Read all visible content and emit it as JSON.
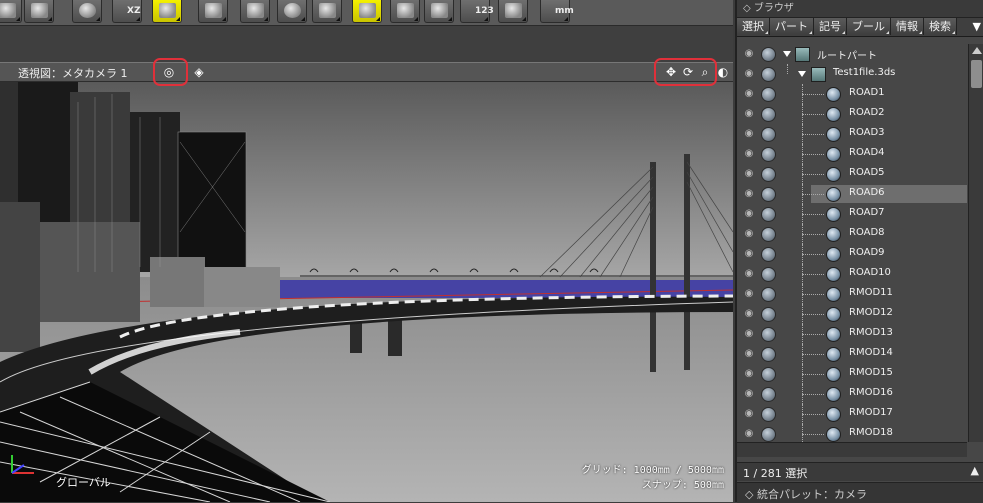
{
  "toolbar": {
    "buttons": [
      {
        "name": "box-icon"
      },
      {
        "name": "list-icon"
      },
      {
        "name": "globe-icon"
      },
      {
        "name": "xz-plane-icon",
        "label": "XZ"
      },
      {
        "name": "grid-single-icon"
      },
      {
        "name": "grid-multi-icon"
      },
      {
        "name": "table-icon"
      },
      {
        "name": "cylinder-icon"
      },
      {
        "name": "car-icon"
      },
      {
        "name": "select-grid-icon"
      },
      {
        "name": "cubes-icon"
      },
      {
        "name": "chart-icon"
      },
      {
        "name": "numeric-input-icon",
        "label": "123"
      },
      {
        "name": "measure-icon"
      },
      {
        "name": "unit-mm-icon",
        "label": "mm"
      }
    ]
  },
  "viewport": {
    "title": "透視図：メタカメラ 1",
    "grid_text": "グリッド: 1000mm / 5000mm",
    "snap_text": "スナップ: 500mm",
    "global_label": "グローバル"
  },
  "browser": {
    "title": "ブラウザ",
    "tabs": [
      "選択",
      "パート",
      "記号",
      "ブール",
      "情報",
      "検索"
    ],
    "tree": [
      {
        "label": "ルートパート",
        "type": "group",
        "depth": 0,
        "expanded": true
      },
      {
        "label": "Test1file.3ds",
        "type": "group",
        "depth": 1,
        "expanded": true
      },
      {
        "label": "ROAD1",
        "type": "part",
        "depth": 2
      },
      {
        "label": "ROAD2",
        "type": "part",
        "depth": 2
      },
      {
        "label": "ROAD3",
        "type": "part",
        "depth": 2
      },
      {
        "label": "ROAD4",
        "type": "part",
        "depth": 2
      },
      {
        "label": "ROAD5",
        "type": "part",
        "depth": 2
      },
      {
        "label": "ROAD6",
        "type": "part",
        "depth": 2,
        "selected": true
      },
      {
        "label": "ROAD7",
        "type": "part",
        "depth": 2
      },
      {
        "label": "ROAD8",
        "type": "part",
        "depth": 2
      },
      {
        "label": "ROAD9",
        "type": "part",
        "depth": 2
      },
      {
        "label": "ROAD10",
        "type": "part",
        "depth": 2
      },
      {
        "label": "RMOD11",
        "type": "part",
        "depth": 2
      },
      {
        "label": "RMOD12",
        "type": "part",
        "depth": 2
      },
      {
        "label": "RMOD13",
        "type": "part",
        "depth": 2
      },
      {
        "label": "RMOD14",
        "type": "part",
        "depth": 2
      },
      {
        "label": "RMOD15",
        "type": "part",
        "depth": 2
      },
      {
        "label": "RMOD16",
        "type": "part",
        "depth": 2
      },
      {
        "label": "RMOD17",
        "type": "part",
        "depth": 2
      },
      {
        "label": "RMOD18",
        "type": "part",
        "depth": 2
      }
    ],
    "selection_count": "1 / 281 選択",
    "palette_label": "統合パレット：カメラ"
  }
}
